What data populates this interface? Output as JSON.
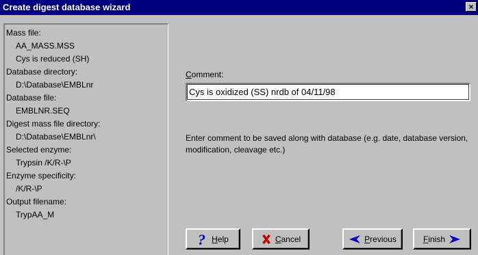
{
  "window": {
    "title": "Create digest database wizard",
    "close_symbol": "×"
  },
  "summary": {
    "lines": [
      {
        "text": "Mass file:",
        "kind": "label"
      },
      {
        "text": "AA_MASS.MSS",
        "kind": "value"
      },
      {
        "text": "Cys is reduced (SH)",
        "kind": "value"
      },
      {
        "text": "Database directory:",
        "kind": "label"
      },
      {
        "text": "D:\\Database\\EMBLnr",
        "kind": "value"
      },
      {
        "text": "Database file:",
        "kind": "label"
      },
      {
        "text": "EMBLNR.SEQ",
        "kind": "value"
      },
      {
        "text": "Digest mass file directory:",
        "kind": "label"
      },
      {
        "text": "D:\\Database\\EMBLnr\\",
        "kind": "value"
      },
      {
        "text": "Selected enzyme:",
        "kind": "label"
      },
      {
        "text": "Trypsin     /K/R-\\P",
        "kind": "value"
      },
      {
        "text": "Enzyme specificity:",
        "kind": "label"
      },
      {
        "text": "/K/R-\\P",
        "kind": "value"
      },
      {
        "text": "Output filename:",
        "kind": "label"
      },
      {
        "text": "TrypAA_M",
        "kind": "value"
      }
    ]
  },
  "comment": {
    "label_first": "C",
    "label_rest": "omment:",
    "value": "Cys is oxidized (SS) nrdb of 04/11/98"
  },
  "hint": "Enter comment to be saved along with database (e.g. date, database version, modification, cleavage etc.)",
  "buttons": {
    "help": {
      "first": "H",
      "rest": "elp"
    },
    "cancel": {
      "first": "C",
      "rest": "ancel"
    },
    "previous": {
      "first": "P",
      "rest": "revious"
    },
    "finish": {
      "first": "F",
      "rest": "inish"
    }
  },
  "colors": {
    "title_bar": "#000080",
    "face": "#c0c0c0",
    "help_icon": "#0000c0",
    "cancel_icon": "#c00000",
    "arrow_icon": "#0000c0"
  }
}
